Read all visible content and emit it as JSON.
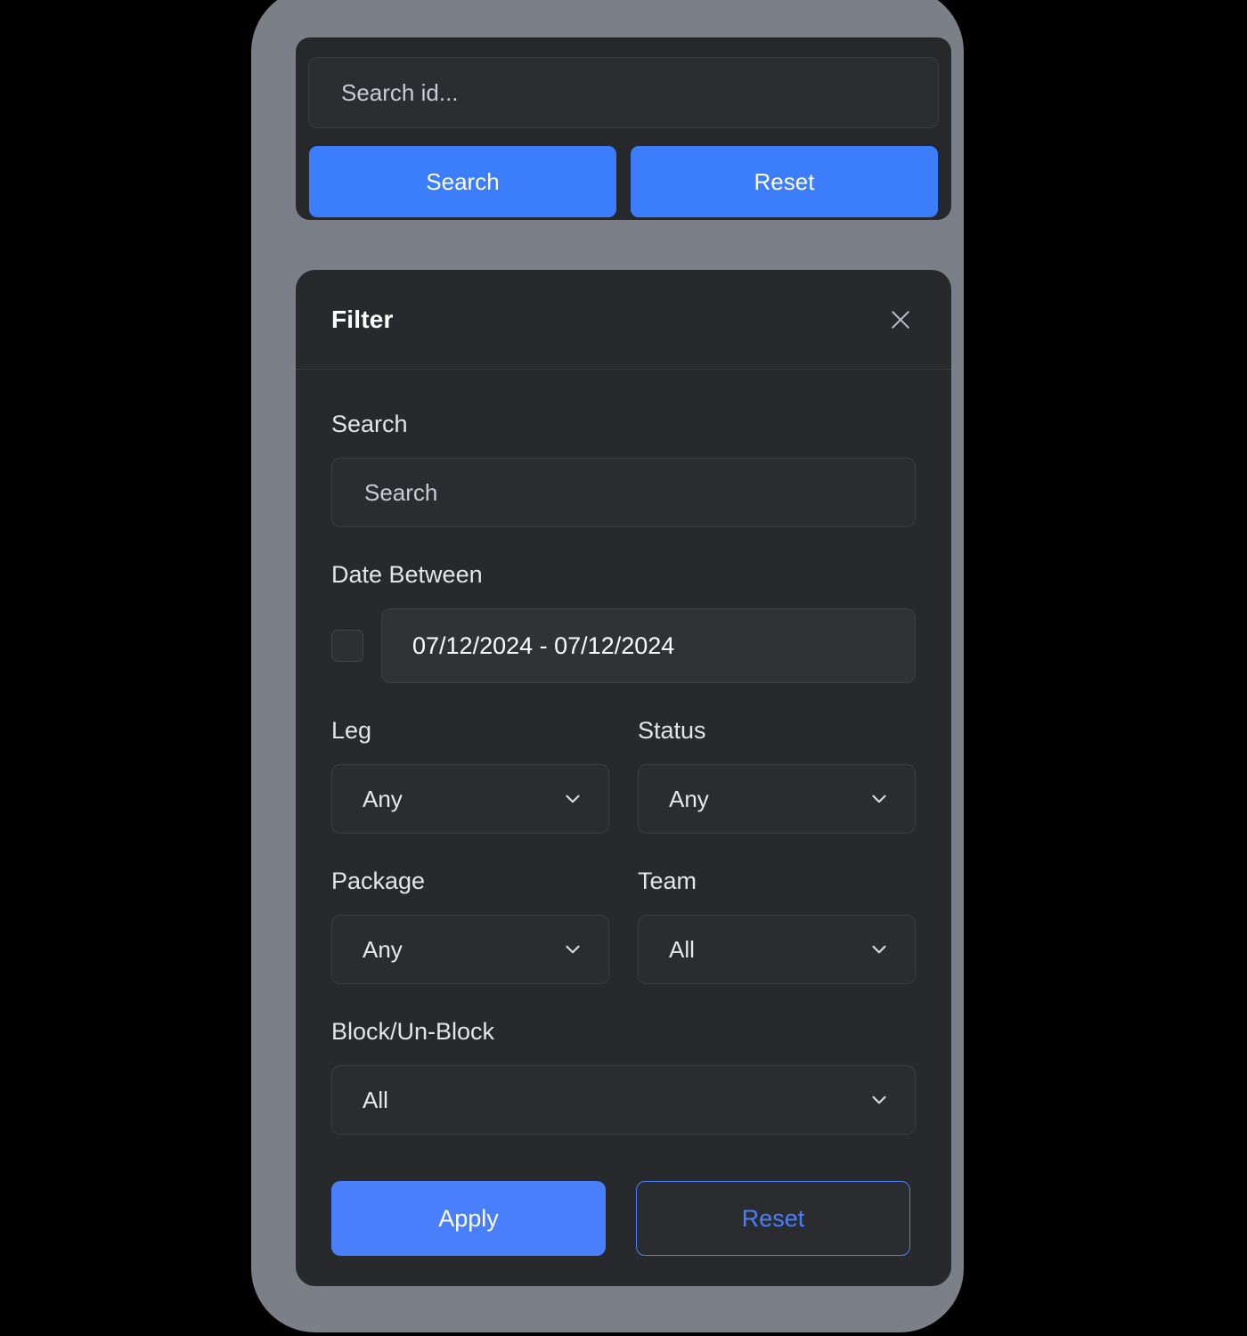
{
  "search_card": {
    "search_input": {
      "value": "",
      "placeholder": "Search id..."
    },
    "search_button_label": "Search",
    "reset_button_label": "Reset"
  },
  "filter_panel": {
    "title": "Filter",
    "close_icon": "close-icon",
    "search_section": {
      "label": "Search",
      "input_value": "",
      "input_placeholder": "Search"
    },
    "date_section": {
      "label": "Date Between",
      "checkbox_checked": false,
      "date_value": "07/12/2024 - 07/12/2024"
    },
    "selects": [
      {
        "label": "Leg",
        "value": "Any",
        "icon": "chevron-down-icon"
      },
      {
        "label": "Status",
        "value": "Any",
        "icon": "chevron-down-icon"
      },
      {
        "label": "Package",
        "value": "Any",
        "icon": "chevron-down-icon"
      },
      {
        "label": "Team",
        "value": "All",
        "icon": "chevron-down-icon"
      },
      {
        "label": "Block/Un-Block",
        "value": "All",
        "icon": "chevron-down-icon"
      }
    ],
    "apply_button_label": "Apply",
    "reset_button_label": "Reset"
  },
  "colors": {
    "accent_blue": "#3b7dfb",
    "apply_blue": "#4a7ffb",
    "backdrop_gray": "#7b8088",
    "panel_bg": "#27292c",
    "card_bg": "#26282b",
    "field_bg": "#2a2c2f",
    "page_bg": "#000000"
  }
}
